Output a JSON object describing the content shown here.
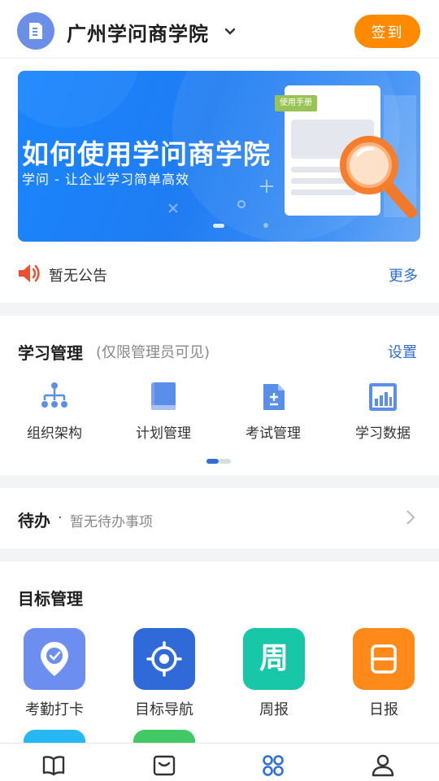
{
  "header": {
    "org_name": "广州学问商学院",
    "signin_label": "签到"
  },
  "banner": {
    "title": "如何使用学问商学院",
    "subtitle": "学问 - 让企业学习简单高效",
    "tag": "使用手册"
  },
  "notice": {
    "text": "暂无公告",
    "more_label": "更多"
  },
  "learning": {
    "title": "学习管理",
    "note": "(仅限管理员可见)",
    "settings_label": "设置",
    "items": [
      {
        "label": "组织架构",
        "icon": "org-chart-icon"
      },
      {
        "label": "计划管理",
        "icon": "book-icon"
      },
      {
        "label": "考试管理",
        "icon": "exam-doc-icon"
      },
      {
        "label": "学习数据",
        "icon": "bar-chart-icon"
      }
    ]
  },
  "todo": {
    "title": "待办",
    "dot": "·",
    "status": "暂无待办事项"
  },
  "goals": {
    "title": "目标管理",
    "items": [
      {
        "label": "考勤打卡",
        "icon": "location-check-icon",
        "color": "#6b8ef0"
      },
      {
        "label": "目标导航",
        "icon": "target-icon",
        "color": "#2f6ad8"
      },
      {
        "label": "周报",
        "icon": "weekly-report-icon",
        "color": "#18c7a8",
        "glyph": "周"
      },
      {
        "label": "日报",
        "icon": "daily-report-icon",
        "color": "#ff8a1a"
      }
    ]
  },
  "tabs": [
    {
      "icon": "open-book-icon",
      "active": false
    },
    {
      "icon": "inbox-icon",
      "active": false
    },
    {
      "icon": "apps-icon",
      "active": true
    },
    {
      "icon": "user-icon",
      "active": false
    }
  ],
  "colors": {
    "accent": "#2f6fd6",
    "signin": "#ff8a00",
    "banner": "#1a86ff"
  }
}
